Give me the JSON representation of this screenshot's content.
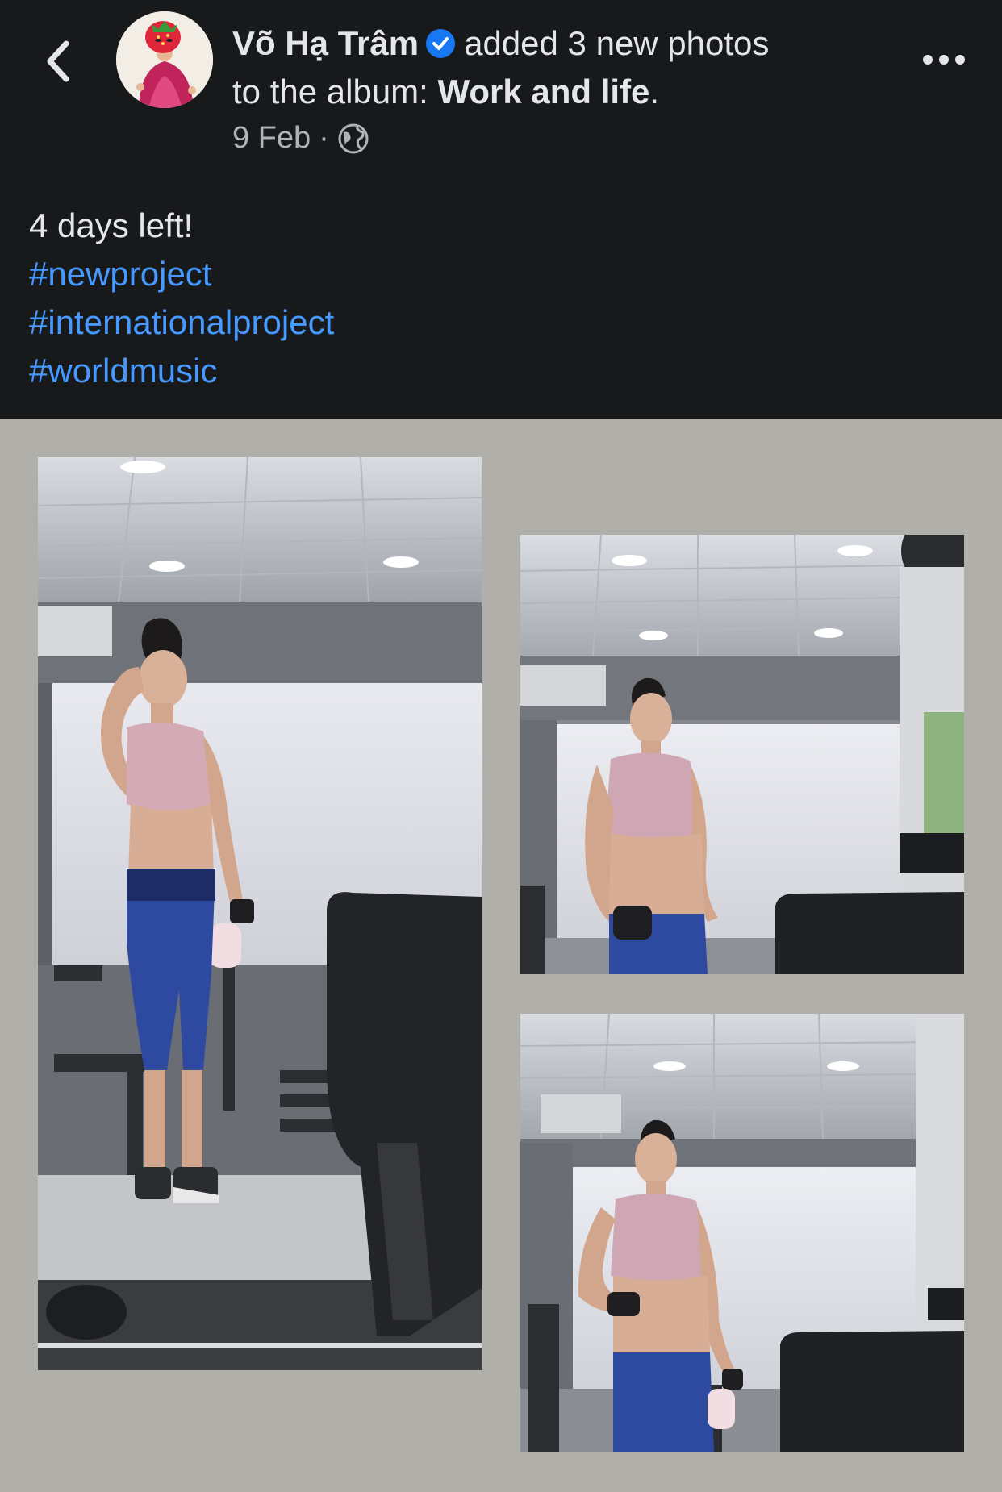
{
  "header": {
    "back_icon": "chevron-left-icon",
    "author_name": "Võ Hạ Trâm",
    "verified_icon": "verified-badge-icon",
    "action_text": "added 3 new photos",
    "album_prefix": "to the album:",
    "album_name": "Work and life",
    "album_suffix": ".",
    "date": "9 Feb",
    "separator": "·",
    "privacy_icon": "globe-icon",
    "more_icon": "more-horizontal-icon"
  },
  "post": {
    "text": "4 days left!",
    "hashtags": [
      "#newproject",
      "#internationalproject",
      "#worldmusic"
    ]
  },
  "colors": {
    "background": "#18191a",
    "text_primary": "#e4e6eb",
    "text_secondary": "#b0b3b8",
    "link": "#4599ff",
    "verified": "#1877f2",
    "photo_area": "#b0afa9"
  },
  "photos": [
    {
      "label": "photo-1"
    },
    {
      "label": "photo-2"
    },
    {
      "label": "photo-3"
    }
  ]
}
